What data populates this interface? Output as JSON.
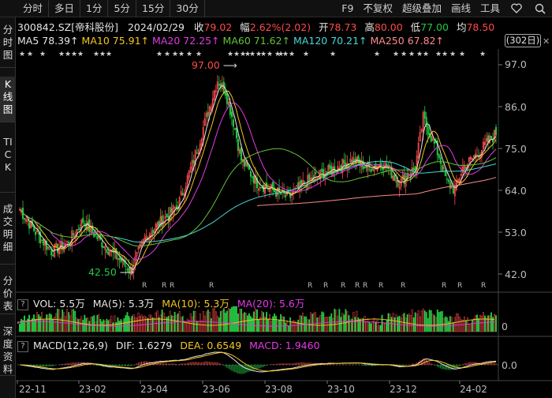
{
  "toolbar": {
    "left_items": [
      "分时",
      "多日",
      "1分",
      "5分",
      "15分",
      "30分"
    ],
    "right_items": [
      "F9",
      "不复权",
      "超级叠加",
      "画线",
      "工具"
    ],
    "favorite_icon": "heart-icon",
    "search_icon": "search-icon"
  },
  "sidebar": {
    "tabs": [
      {
        "label": "分时图",
        "active": false
      },
      {
        "label": "K线图",
        "active": true
      },
      {
        "label": "TICK",
        "active": false
      },
      {
        "label": "成交明细",
        "active": false
      },
      {
        "label": "分价表",
        "active": false
      },
      {
        "label": "深度资料",
        "active": false
      }
    ]
  },
  "info": {
    "code_name": "300842.SZ[帝科股份]",
    "date": "2024/02/29",
    "close_label": "收",
    "close": "79.02",
    "change_label": "幅",
    "change": "2.62%(2.02)",
    "open_label": "开",
    "open": "78.73",
    "high_label": "高",
    "high": "80.00",
    "low_label": "低",
    "low": "77.00",
    "last_label": "均",
    "last": "78.50"
  },
  "ma": {
    "ma5_label": "MA5",
    "ma5": "78.39↑",
    "ma10_label": "MA10",
    "ma10": "75.91↑",
    "ma20_label": "MA20",
    "ma20": "72.25↑",
    "ma60_label": "MA60",
    "ma60": "71.62↑",
    "ma120_label": "MA120",
    "ma120": "70.21↑",
    "ma250_label": "MA250",
    "ma250": "67.82↑"
  },
  "badge": "(302日)",
  "close_icon": "close-icon",
  "annotations": {
    "high": "97.00",
    "low": "42.50"
  },
  "price_axis": [
    "97.0",
    "86.0",
    "75.0",
    "64.0",
    "53.0",
    "42.0"
  ],
  "vol_panel": {
    "q": "?",
    "vol_label": "VOL: 5.5万",
    "ma5": "MA(5): 5.3万",
    "ma10": "MA(10): 5.3万",
    "ma20": "MA(20): 5.6万",
    "axis": "0"
  },
  "macd_panel": {
    "q": "?",
    "label": "MACD(12,26,9)",
    "dif": "DIF: 1.6279",
    "dea": "DEA: 0.6549",
    "macd": "MACD: 1.9460",
    "axis": "0.0"
  },
  "date_axis": [
    "22-11",
    "23-02",
    "23-04",
    "23-06",
    "23-08",
    "23-10",
    "23-12",
    "24-02"
  ],
  "colors": {
    "up": "#ff4a4a",
    "down": "#23c843",
    "ma5": "#e6e6e6",
    "ma10": "#f3c623",
    "ma20": "#e23be3",
    "ma60": "#63c23a",
    "ma120": "#48d6d6",
    "ma250": "#ff8a8a"
  },
  "chart_data": {
    "type": "candlestick",
    "x_range": [
      "2022-11",
      "2024-02"
    ],
    "ylim": [
      40,
      99
    ],
    "ma_close_series": {
      "anchors_index": [
        0,
        10,
        20,
        30,
        40,
        50,
        60,
        70,
        80,
        90,
        100,
        110,
        120,
        125,
        130,
        135,
        140,
        150,
        160,
        170,
        180,
        190,
        200,
        210,
        220,
        230,
        240,
        250,
        255,
        260,
        265,
        270,
        275,
        280,
        290,
        301
      ],
      "anchors_price": [
        59,
        53,
        48,
        50,
        56,
        51,
        47,
        43,
        52,
        56,
        60,
        72,
        86,
        93,
        90,
        82,
        72,
        66,
        64,
        62,
        66,
        68,
        70,
        72,
        70,
        71,
        66,
        70,
        83,
        78,
        73,
        66,
        64,
        70,
        74,
        79
      ]
    }
  }
}
